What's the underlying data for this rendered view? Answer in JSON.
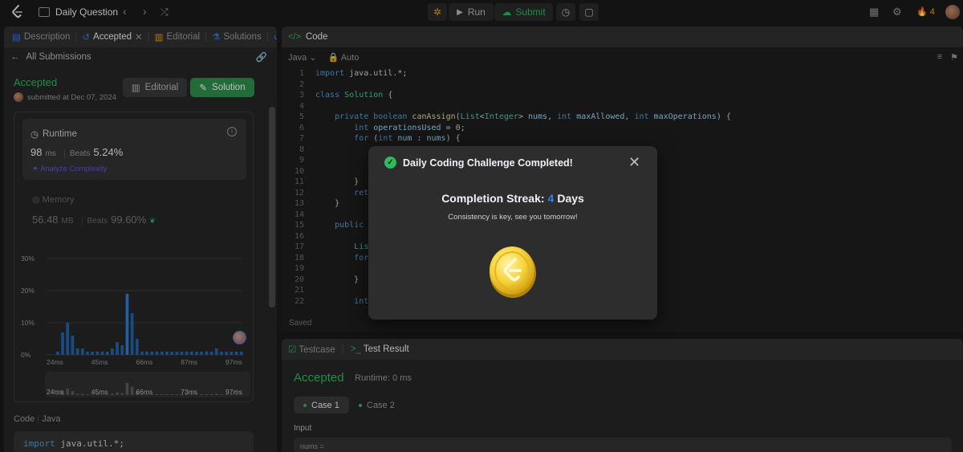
{
  "topbar": {
    "title": "Daily Question",
    "run_label": "Run",
    "submit_label": "Submit",
    "streak_count": "4"
  },
  "left": {
    "tabs": [
      "Description",
      "Accepted",
      "Editorial",
      "Solutions"
    ],
    "back_label": "All Submissions",
    "status": "Accepted",
    "submitted_at": "submitted at Dec 07, 2024",
    "editorial_btn": "Editorial",
    "solution_btn": "Solution",
    "runtime": {
      "label": "Runtime",
      "value": "98",
      "unit": "ms",
      "beats_label": "Beats",
      "beats_value": "5.24%",
      "analyze": "Analyze Complexity"
    },
    "memory": {
      "label": "Memory",
      "value": "56.48",
      "unit": "MB",
      "beats_label": "Beats",
      "beats_value": "99.60%"
    },
    "code_label": "Code",
    "code_lang": "Java",
    "code_snippet_kw": "import",
    "code_snippet_rest": " java.util.*;"
  },
  "chart_data": {
    "type": "bar",
    "yticks": [
      "30%",
      "20%",
      "10%",
      "0%"
    ],
    "ylim": [
      0,
      30
    ],
    "xticks": [
      "24ms",
      "45ms",
      "66ms",
      "87ms",
      "97ms"
    ],
    "values": [
      1,
      7,
      10,
      6,
      2,
      2,
      1,
      1,
      1,
      1,
      1,
      2,
      4,
      3,
      19,
      13,
      5,
      1,
      1,
      1,
      1,
      1,
      1,
      1,
      1,
      1,
      1,
      1,
      1,
      1,
      1,
      1,
      2,
      1,
      1,
      1,
      1,
      1
    ],
    "mini_xticks": [
      "24ms",
      "45ms",
      "66ms",
      "73ms",
      "97ms"
    ],
    "highlight_index": 14
  },
  "code_panel": {
    "title": "Code",
    "lang": "Java",
    "mode": "Auto",
    "saved": "Saved"
  },
  "bottom": {
    "testcase_tab": "Testcase",
    "result_tab": "Test Result",
    "status": "Accepted",
    "runtime": "Runtime: 0 ms",
    "case1": "Case 1",
    "case2": "Case 2",
    "input_label": "Input",
    "input_value": "nums ="
  },
  "modal": {
    "title": "Daily Coding Challenge Completed!",
    "streak_label": "Completion Streak:",
    "streak_value": "4",
    "streak_unit": "Days",
    "motto": "Consistency is key, see you tomorrow!"
  },
  "colors": {
    "accent_green": "#2cbb5d",
    "brand_orange": "#ffa116",
    "streak_blue": "#2f80ed"
  }
}
